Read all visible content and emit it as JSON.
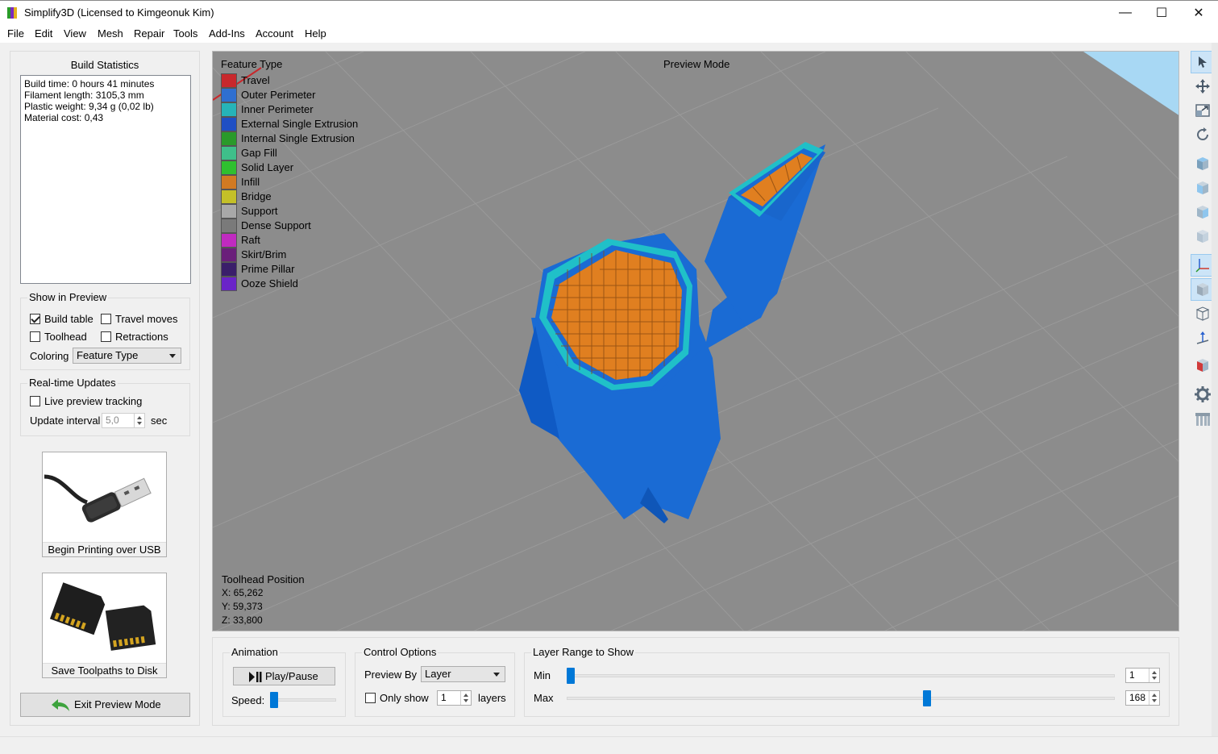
{
  "window": {
    "title": "Simplify3D (Licensed to Kimgeonuk Kim)",
    "controls": {
      "minimize": "—",
      "maximize": "☐",
      "close": "✕"
    }
  },
  "menu": [
    "File",
    "Edit",
    "View",
    "Mesh",
    "Repair",
    "Tools",
    "Add-Ins",
    "Account",
    "Help"
  ],
  "build_stats": {
    "heading": "Build Statistics",
    "lines": [
      "Build time: 0 hours 41 minutes",
      "Filament length: 3105,3 mm",
      "Plastic weight: 9,34 g (0,02 lb)",
      "Material cost: 0,43"
    ]
  },
  "show_in_preview": {
    "title": "Show in Preview",
    "build_table": {
      "label": "Build table",
      "checked": true
    },
    "travel_moves": {
      "label": "Travel moves",
      "checked": false
    },
    "toolhead": {
      "label": "Toolhead",
      "checked": false
    },
    "retractions": {
      "label": "Retractions",
      "checked": false
    },
    "coloring_label": "Coloring",
    "coloring_value": "Feature Type"
  },
  "realtime": {
    "title": "Real-time Updates",
    "live_tracking": {
      "label": "Live preview tracking",
      "checked": false
    },
    "interval_label": "Update interval",
    "interval_value": "5,0",
    "interval_unit": "sec"
  },
  "actions": {
    "usb": "Begin Printing over USB",
    "disk": "Save Toolpaths to Disk",
    "exit": "Exit Preview Mode"
  },
  "viewport": {
    "legend_title": "Feature Type",
    "preview_mode": "Preview Mode",
    "legend": [
      {
        "label": "Travel",
        "color": "#c8282c"
      },
      {
        "label": "Outer Perimeter",
        "color": "#2f6fd0"
      },
      {
        "label": "Inner Perimeter",
        "color": "#26b3b8"
      },
      {
        "label": "External Single Extrusion",
        "color": "#1f4fc4"
      },
      {
        "label": "Internal Single Extrusion",
        "color": "#2a9a2a"
      },
      {
        "label": "Gap Fill",
        "color": "#3fbf8a"
      },
      {
        "label": "Solid Layer",
        "color": "#2fc02f"
      },
      {
        "label": "Infill",
        "color": "#d27a22"
      },
      {
        "label": "Bridge",
        "color": "#c4c028"
      },
      {
        "label": "Support",
        "color": "#a8a8a8"
      },
      {
        "label": "Dense Support",
        "color": "#7a7a7a"
      },
      {
        "label": "Raft",
        "color": "#c02ac0"
      },
      {
        "label": "Skirt/Brim",
        "color": "#6a1e7a"
      },
      {
        "label": "Prime Pillar",
        "color": "#3a1e6a"
      },
      {
        "label": "Ooze Shield",
        "color": "#6a24c8"
      }
    ],
    "toolhead": {
      "title": "Toolhead Position",
      "x": "X: 65,262",
      "y": "Y: 59,373",
      "z": "Z: 33,800"
    }
  },
  "toolbar_icons": [
    "select-arrow-icon",
    "move-icon",
    "scale-icon",
    "rotate-icon",
    "view-cube-top-icon",
    "view-cube-front-icon",
    "view-cube-side-icon",
    "view-cube-iso-icon",
    "axes-icon",
    "solid-view-icon",
    "wireframe-icon",
    "normal-icon",
    "cross-section-icon",
    "settings-gear-icon",
    "support-pillars-icon"
  ],
  "animation": {
    "title": "Animation",
    "play_label": "Play/Pause",
    "speed_label": "Speed:"
  },
  "control_options": {
    "title": "Control Options",
    "preview_by_label": "Preview By",
    "preview_by_value": "Layer",
    "only_show_label": "Only show",
    "only_show_value": "1",
    "layers_label": "layers"
  },
  "layer_range": {
    "title": "Layer Range to Show",
    "min_label": "Min",
    "min_value": "1",
    "max_label": "Max",
    "max_value": "168",
    "min_level": 0.0,
    "max_level": 0.65
  }
}
